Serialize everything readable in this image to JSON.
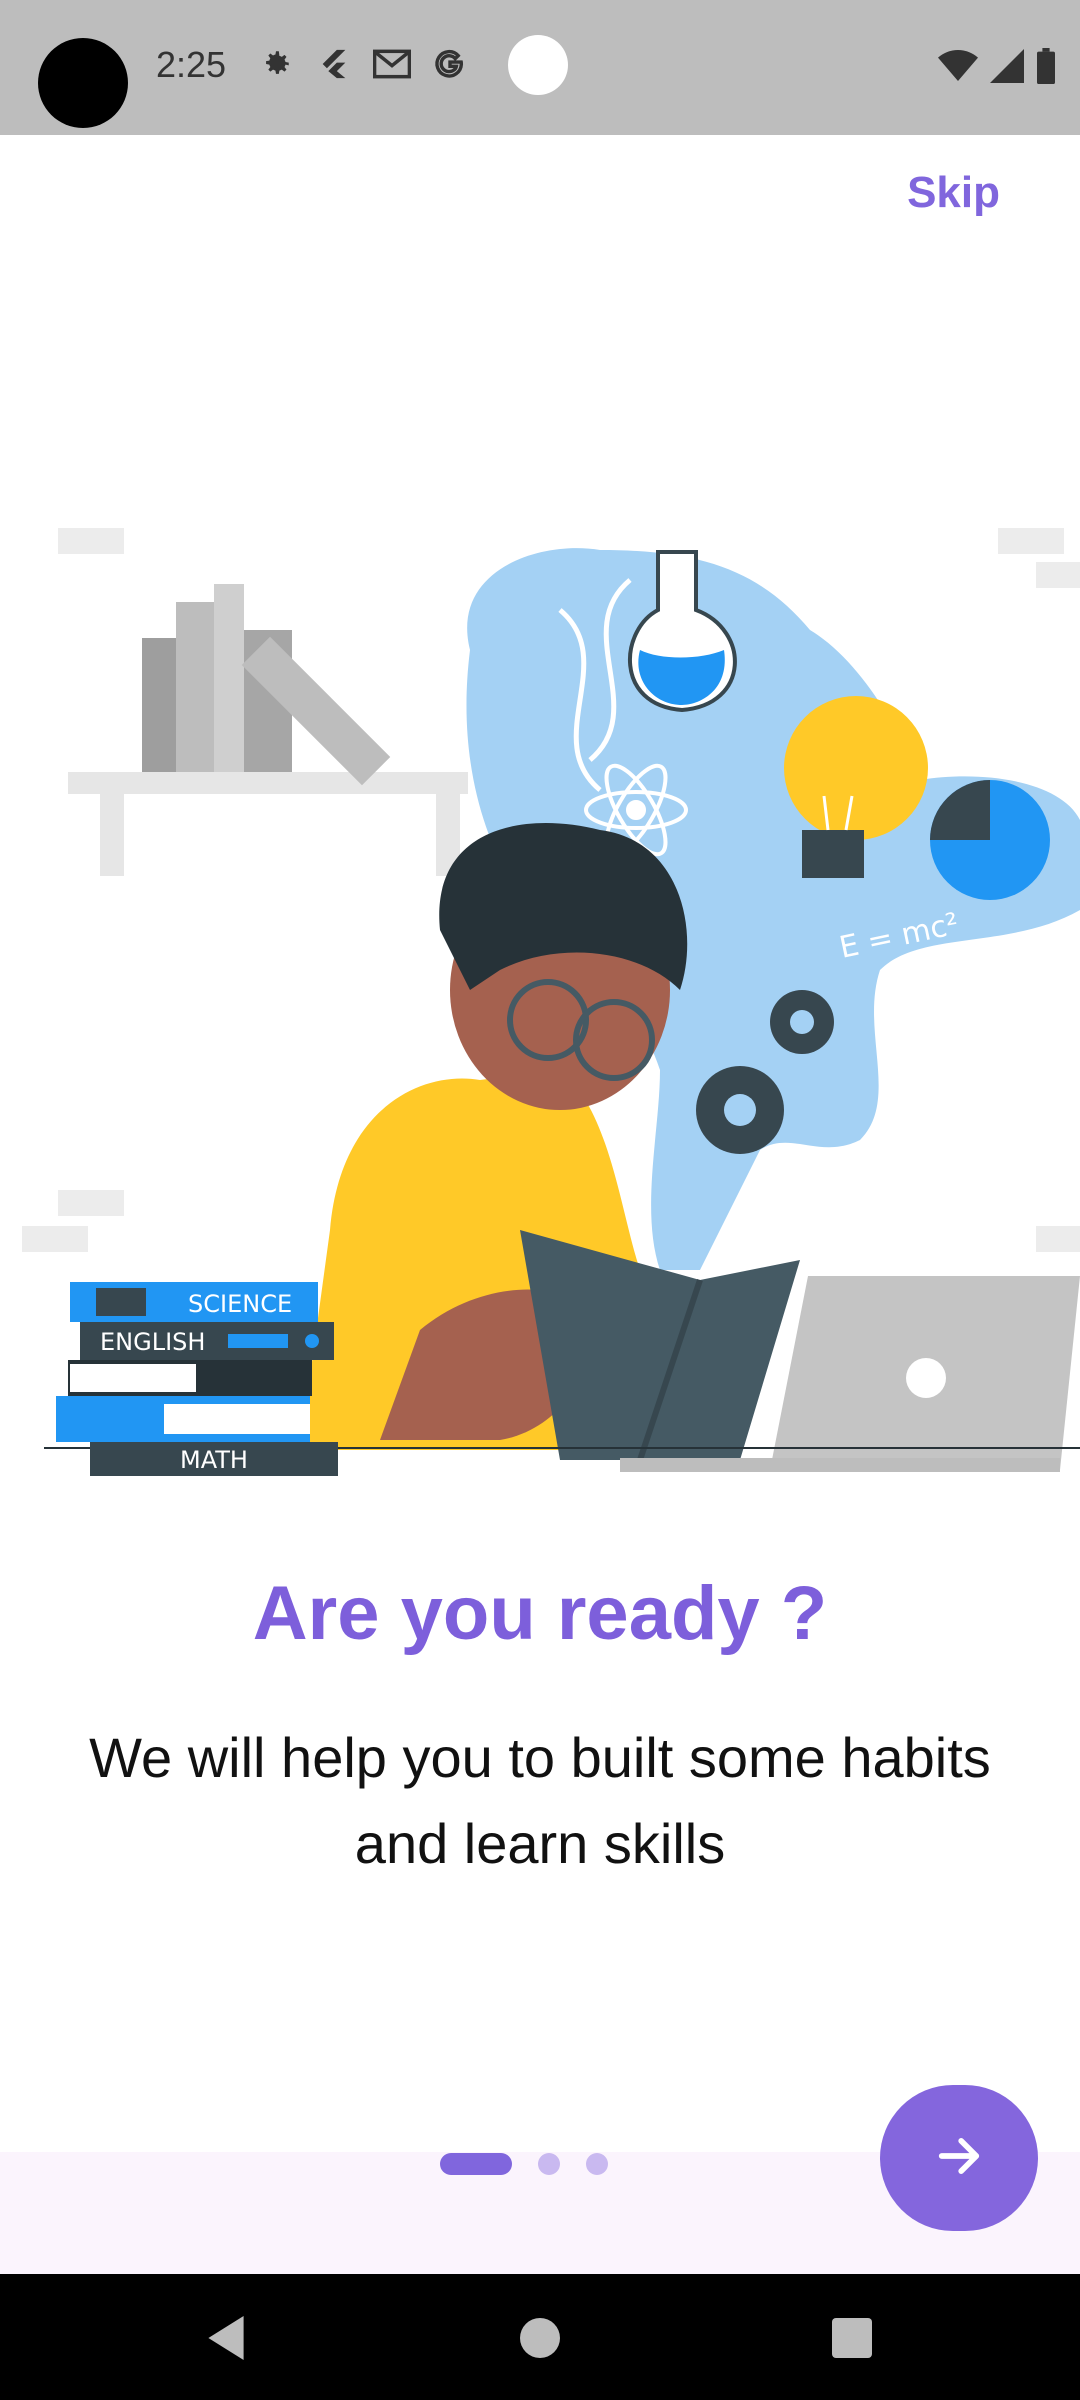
{
  "status_bar": {
    "time": "2:25",
    "left_icons": [
      "gear-icon",
      "flutter-icon",
      "gmail-icon",
      "google-icon"
    ],
    "right_icons": [
      "wifi-icon",
      "signal-icon",
      "battery-icon"
    ]
  },
  "header": {
    "skip_label": "Skip"
  },
  "illustration": {
    "book_labels": [
      "SCIENCE",
      "ENGLISH",
      "MATH"
    ],
    "formula": "E = mc²"
  },
  "content": {
    "title": "Are you ready ?",
    "subtitle": "We will help you to built some habits and learn skills"
  },
  "pager": {
    "total_pages": 3,
    "current_page": 1
  },
  "colors": {
    "accent": "#8066dd",
    "status_bar": "#bdbdbd",
    "bottom_bar": "#fbf4fd"
  },
  "nav_bar": {
    "icons": [
      "back-icon",
      "home-icon",
      "recents-icon"
    ]
  }
}
